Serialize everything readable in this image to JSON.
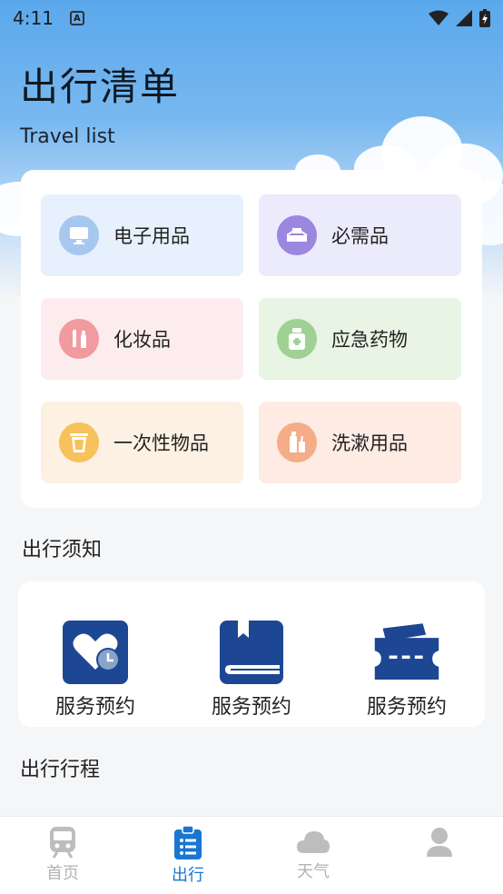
{
  "status_bar": {
    "time": "4:11",
    "badge": "A"
  },
  "header": {
    "title": "出行清单",
    "subtitle": "Travel list"
  },
  "categories": [
    {
      "label": "电子用品",
      "icon": "monitor-icon",
      "bg": "#e6f1fd",
      "circle": "#a6c8ef"
    },
    {
      "label": "必需品",
      "icon": "tray-icon",
      "bg": "#ecebfc",
      "circle": "#9b86e0"
    },
    {
      "label": "化妆品",
      "icon": "cosmetics-icon",
      "bg": "#fdecee",
      "circle": "#f19aa0"
    },
    {
      "label": "应急药物",
      "icon": "medicine-bottle-icon",
      "bg": "#e8f4e4",
      "circle": "#9ed193"
    },
    {
      "label": "一次性物品",
      "icon": "disposable-cup-icon",
      "bg": "#fdf1e4",
      "circle": "#f7c15b"
    },
    {
      "label": "洗漱用品",
      "icon": "toiletries-icon",
      "bg": "#fdebe4",
      "circle": "#f5ac89"
    }
  ],
  "notice": {
    "title": "出行须知",
    "items": [
      {
        "label": "服务预约",
        "icon": "heart-clock-icon"
      },
      {
        "label": "服务预约",
        "icon": "book-icon"
      },
      {
        "label": "服务预约",
        "icon": "ticket-icon"
      }
    ]
  },
  "itinerary": {
    "title": "出行行程"
  },
  "tabs": [
    {
      "label": "首页",
      "icon": "train-icon",
      "active": false
    },
    {
      "label": "出行",
      "icon": "clipboard-list-icon",
      "active": true
    },
    {
      "label": "天气",
      "icon": "cloud-icon",
      "active": false
    },
    {
      "label": "",
      "icon": "user-icon",
      "active": false
    }
  ],
  "colors": {
    "accent": "#1976d2",
    "icon_navy": "#1d4793"
  }
}
